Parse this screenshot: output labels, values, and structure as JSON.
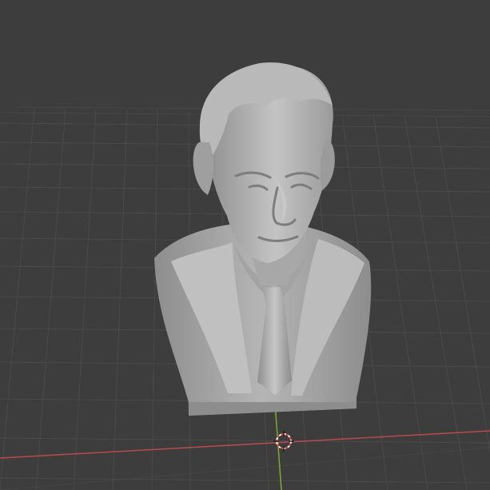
{
  "viewport": {
    "background": "#3d3d3d",
    "grid_color": "#535353",
    "x_axis_color": "#b84a52",
    "y_axis_color": "#7faa2f",
    "object_color": "#a9a9a9"
  },
  "icons": {
    "cursor": "3d-cursor-icon"
  }
}
